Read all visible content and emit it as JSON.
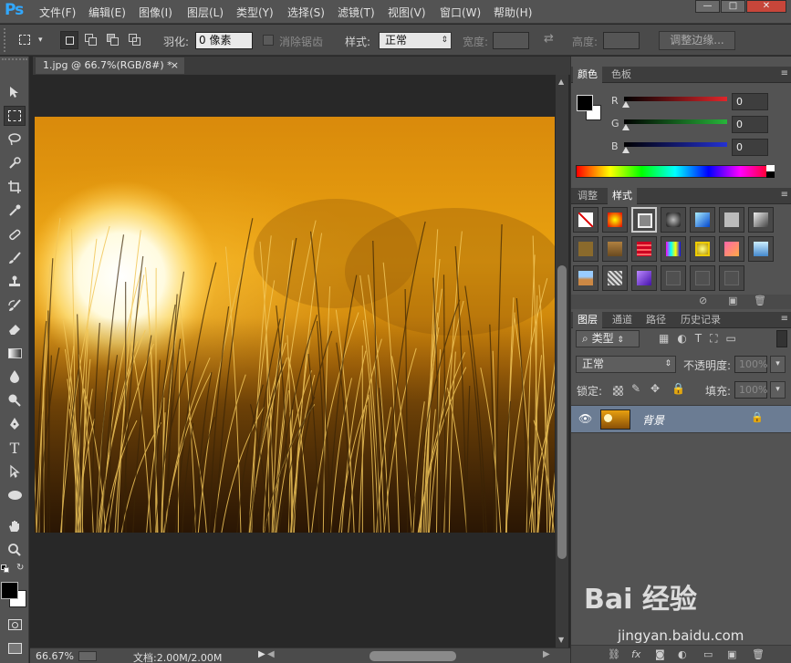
{
  "app": {
    "logo": "Ps"
  },
  "menu": [
    "文件(F)",
    "编辑(E)",
    "图像(I)",
    "图层(L)",
    "类型(Y)",
    "选择(S)",
    "滤镜(T)",
    "视图(V)",
    "窗口(W)",
    "帮助(H)"
  ],
  "window_controls": {
    "minimize": "—",
    "maximize": "□",
    "close": "✕"
  },
  "options": {
    "feather_label": "羽化:",
    "feather_value": "0 像素",
    "antialias_label": "消除锯齿",
    "style_label": "样式:",
    "style_value": "正常",
    "width_label": "宽度:",
    "height_label": "高度:",
    "refine_edge": "调整边缘..."
  },
  "document": {
    "tab_title": "1.jpg @ 66.7%(RGB/8#) *",
    "close_glyph": "×"
  },
  "status": {
    "zoom": "66.67%",
    "doc_info": "文档:2.00M/2.00M"
  },
  "color_panel": {
    "tabs": [
      "颜色",
      "色板"
    ],
    "channels": [
      {
        "label": "R",
        "value": "0",
        "color": "#e0262b"
      },
      {
        "label": "G",
        "value": "0",
        "color": "#27b53a"
      },
      {
        "label": "B",
        "value": "0",
        "color": "#2431d3"
      }
    ]
  },
  "styles_panel": {
    "tabs": [
      "调整",
      "样式"
    ]
  },
  "layers_panel": {
    "tabs": [
      "图层",
      "通道",
      "路径",
      "历史记录"
    ],
    "filter_kind": "类型",
    "blend_mode": "正常",
    "opacity_label": "不透明度:",
    "opacity_value": "100%",
    "lock_label": "锁定:",
    "fill_label": "填充:",
    "fill_value": "100%",
    "layers": [
      {
        "name": "背景",
        "visible": true,
        "locked": true
      }
    ]
  },
  "watermark": {
    "brand": "Bai 经验",
    "url": "jingyan.baidu.com"
  },
  "colors": {
    "accent": "#31a8ff",
    "selected_layer": "#6b7c93",
    "foreground": "#000000",
    "background": "#ffffff"
  }
}
